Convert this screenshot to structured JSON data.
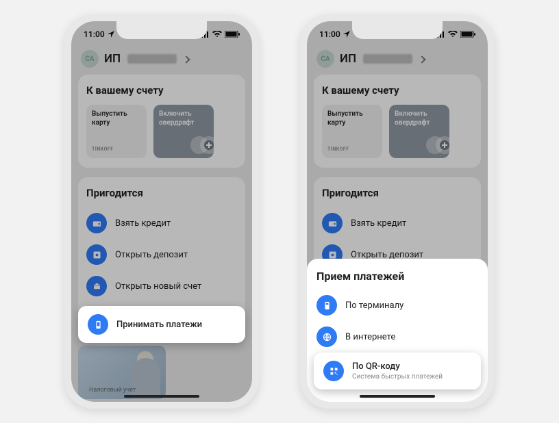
{
  "status": {
    "time": "11:00"
  },
  "header": {
    "prefix": "ИП",
    "avatar_initials": "СА"
  },
  "account_section": {
    "title": "К вашему счету",
    "tile1": {
      "line1": "Выпустить",
      "line2": "карту",
      "brand": "TINKOFF"
    },
    "tile2": {
      "line1": "Включить",
      "line2": "овердрафт"
    }
  },
  "useful_section": {
    "title": "Пригодится",
    "items": [
      {
        "label": "Взять кредит"
      },
      {
        "label": "Открыть депозит"
      },
      {
        "label": "Открыть новый счет"
      },
      {
        "label": "Принимать платежи"
      }
    ]
  },
  "promo": {
    "caption": "Налоговый учет"
  },
  "sheet": {
    "title": "Прием платежей",
    "items": [
      {
        "label": "По терминалу",
        "sub": ""
      },
      {
        "label": "В интернете",
        "sub": ""
      },
      {
        "label": "По QR-коду",
        "sub": "Система быстрых платежей"
      }
    ]
  }
}
